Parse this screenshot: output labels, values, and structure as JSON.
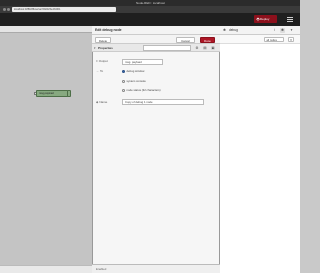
{
  "browser": {
    "title": "Node-RED : localhost",
    "url": "localhost:1880/#flow/1a7d9d0c5e4b3f21"
  },
  "header": {
    "deploy_label": "Deploy",
    "deploy_color": "#8c101c"
  },
  "tray": {
    "title": "Edit debug node",
    "delete_label": "Delete",
    "cancel_label": "Cancel",
    "done_label": "Done",
    "properties_label": "Properties",
    "output_label": "Output",
    "output_value": "msg. payload",
    "to_label": "To",
    "to_options": [
      "debug window",
      "system console",
      "node status (32 characters)"
    ],
    "to_selected": 0,
    "name_label": "Name",
    "name_value": "Copy of debug 1 node",
    "footer_label": "Enabled"
  },
  "canvas": {
    "node_label": "msg.payload"
  },
  "sidebar": {
    "tab_label": "debug",
    "filter_label": "all nodes",
    "clear_icon": "trash-icon"
  },
  "colors": {
    "done": "#ad1625",
    "node_fill": "#87a980"
  }
}
